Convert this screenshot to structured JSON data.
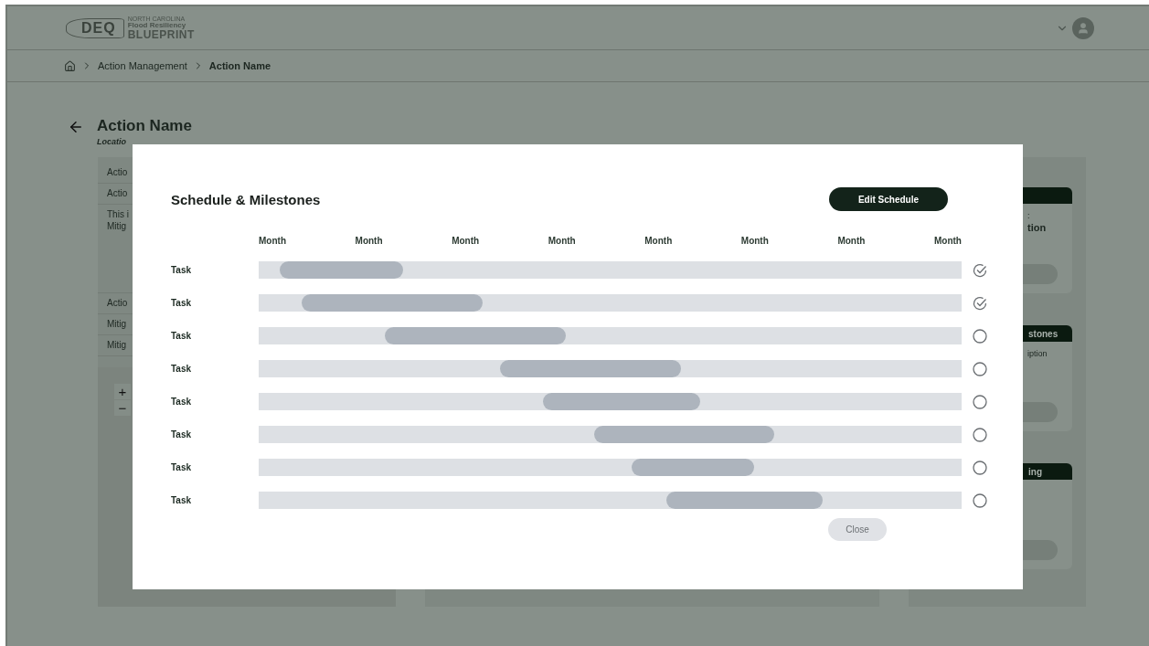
{
  "header": {
    "logo": {
      "mark": "DEQ",
      "state": "NORTH CAROLINA",
      "line1": "Flood Resiliency",
      "line2": "BLUEPRINT"
    }
  },
  "breadcrumb": [
    {
      "label": "Action Management",
      "current": false
    },
    {
      "label": "Action Name",
      "current": true
    }
  ],
  "page": {
    "title": "Action Name",
    "subtitle": "Locatio"
  },
  "left_panel": {
    "rows": [
      [
        "Actio"
      ],
      [
        "Actio"
      ],
      [
        "This i",
        "Mitig"
      ],
      [
        "Actio"
      ],
      [
        "Mitig"
      ],
      [
        "Mitig"
      ]
    ],
    "zoom_controls": [
      "+",
      "−"
    ]
  },
  "right_cards": [
    {
      "lines": [
        ":",
        "tion"
      ]
    },
    {
      "header": "stones",
      "lines": [
        "iption"
      ]
    },
    {
      "header": "ing"
    }
  ],
  "modal": {
    "title": "Schedule & Milestones",
    "edit_button": "Edit Schedule",
    "months": [
      "Month",
      "Month",
      "Month",
      "Month",
      "Month",
      "Month",
      "Month",
      "Month"
    ],
    "tasks": [
      {
        "name": "Task",
        "done": true
      },
      {
        "name": "Task",
        "done": true
      },
      {
        "name": "Task",
        "done": false
      },
      {
        "name": "Task",
        "done": false
      },
      {
        "name": "Task",
        "done": false
      },
      {
        "name": "Task",
        "done": false
      },
      {
        "name": "Task",
        "done": false
      },
      {
        "name": "Task",
        "done": false
      }
    ],
    "close_button": "Close"
  }
}
